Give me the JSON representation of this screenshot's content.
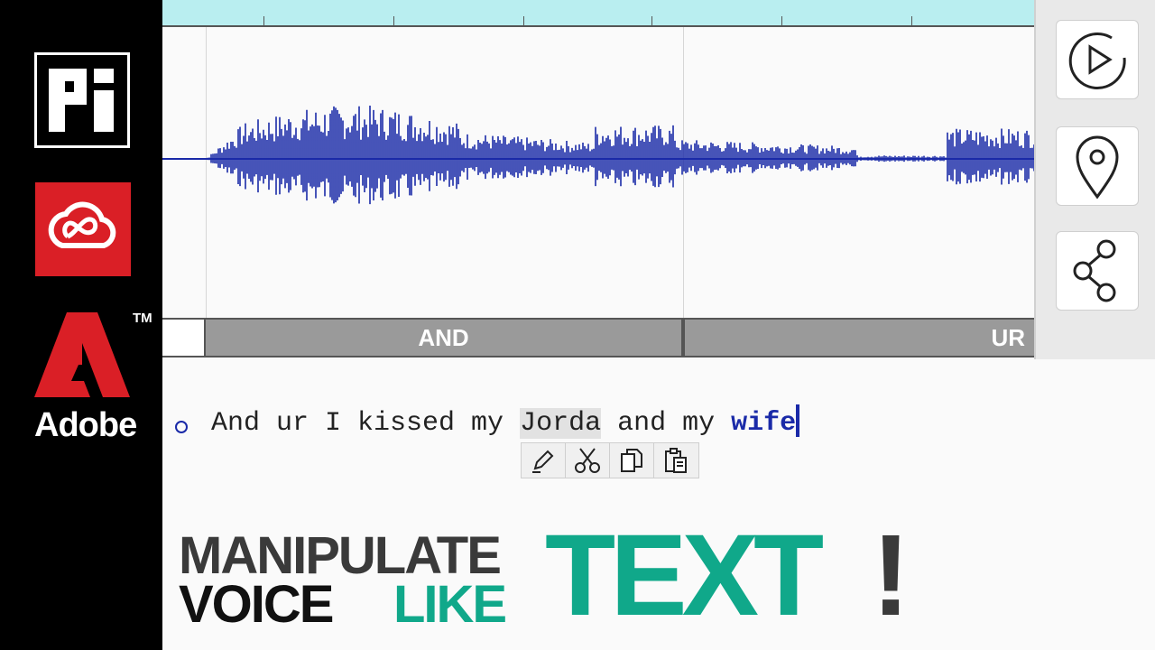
{
  "sidebar": {
    "logos": [
      "pi-logo",
      "creative-cloud-logo",
      "adobe-logo"
    ],
    "adobe_wordmark": "Adobe",
    "trademark": "TM"
  },
  "editor": {
    "segments": [
      "AND",
      "UR"
    ],
    "tools": [
      "play-icon",
      "location-pin-icon",
      "share-icon"
    ]
  },
  "transcript": {
    "words": {
      "part1": "And ur I kissed my ",
      "highlighted": "Jorda",
      "part2": " and my ",
      "edited": "wife"
    }
  },
  "edit_toolbar": [
    "pencil-icon",
    "scissors-icon",
    "copy-icon",
    "paste-icon"
  ],
  "headline": {
    "line1": "MANIPULATE",
    "line2a": "VOICE",
    "line2b": "LIKE",
    "big": "TEXT",
    "bang": "!"
  },
  "colors": {
    "waveform": "#1a2aa8",
    "accent": "#10a88a",
    "ruler": "#b9eef0",
    "segment": "#9a9a9a"
  }
}
